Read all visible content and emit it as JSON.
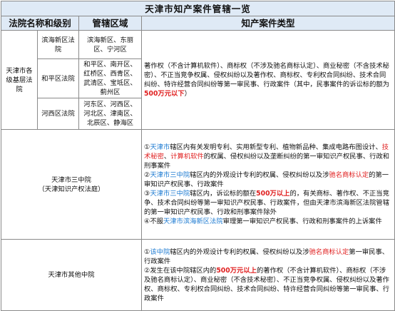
{
  "title": "天津市知产案件管辖一览",
  "headers": {
    "court": "法院名称和级别",
    "area": "管辖区域",
    "types": "知产案件类型"
  },
  "basic_courts": {
    "label": "天津市各级基层法院",
    "sub": [
      {
        "name": "滨海新区法院",
        "area": "滨海新区、东丽区、宁河区"
      },
      {
        "name": "和平区法院",
        "area": "和平区、南开区、红桥区、西青区、武清区、宝坻区、蓟州区"
      },
      {
        "name": "河西区法院",
        "area": "河东区、河西区、河北区、津南区、北辰区、静海区"
      }
    ],
    "types": {
      "p1": "著作权（不含计算机软件）、商标权（不涉及驰名商标认定）、商业秘密（不含技术秘密）、不正当竞争权属、侵权纠纷以及著作权、商标权、专利权合同纠纷、技术合同纠纷、特许经营合同纠纷等第一审民事、行政案件（其中，民事案件的诉讼标的额为",
      "amount": "500万元以下",
      "end": "）"
    }
  },
  "third_court": {
    "name": "天津市三中院",
    "alias": "（天津知识产权法庭）",
    "items": [
      {
        "prefix": "①",
        "place": "天津市",
        "t1": "辖区内有关发明专利、实用新型专利、植物新品种、集成电路布图设计、",
        "hl1": "技术秘密",
        "sep": "、",
        "hl2": "计算机软件",
        "t2": "的权属、侵权纠纷以及垄断纠纷的第一审知识产权民事、行政和刑事案件"
      },
      {
        "prefix": "②",
        "place": "天津市三中院",
        "t1": "辖区内的外观设计专利的权属、侵权纠纷以及涉",
        "hl1": "驰名商标认定",
        "t2": "的第一审知识产权民事、行政案件"
      },
      {
        "prefix": "③",
        "place": "天津市三中院",
        "t1": "辖区内，诉讼标的额在",
        "amount": "500万以上",
        "t2": "的，有关商标、著作权、不正当竞争、技术合同纠纷等第一审知识产权民事、行政案件，但由天津市滨海新区法院管辖的第一审知识产权民事、行政和刑事案件除外"
      },
      {
        "prefix": "④",
        "t1": "不服",
        "place": "天津市滨海新区法院",
        "t2": "审理第一审知识产权民事、行政和刑事案件的上诉案件"
      }
    ]
  },
  "other_courts": {
    "name": "天津市其他中院",
    "items": [
      {
        "prefix": "①",
        "place": "该中院",
        "t1": "辖区内的外观设计专利的权属、侵权纠纷以及涉",
        "hl1": "驰名商标认定",
        "t2": "第一审民事、行政案件"
      },
      {
        "prefix": "②",
        "t1": "发生在该中院辖区内的",
        "amount": "500万元以上",
        "t2": "的著作权（不含计算机软件）、商标权（不涉及驰名商标认定）、商业秘密（不含技术秘密）、不正当竞争权属、侵权纠纷以及著作权、商标权、专利权合同纠纷、技术合同纠纷、特许经营合同纠纷等第一审民事、行政案件"
      }
    ]
  },
  "colors": {
    "header_bg": "#dfeaf6",
    "border": "#8a8a8a",
    "red": "#e02020",
    "blue": "#1e7bd2"
  }
}
